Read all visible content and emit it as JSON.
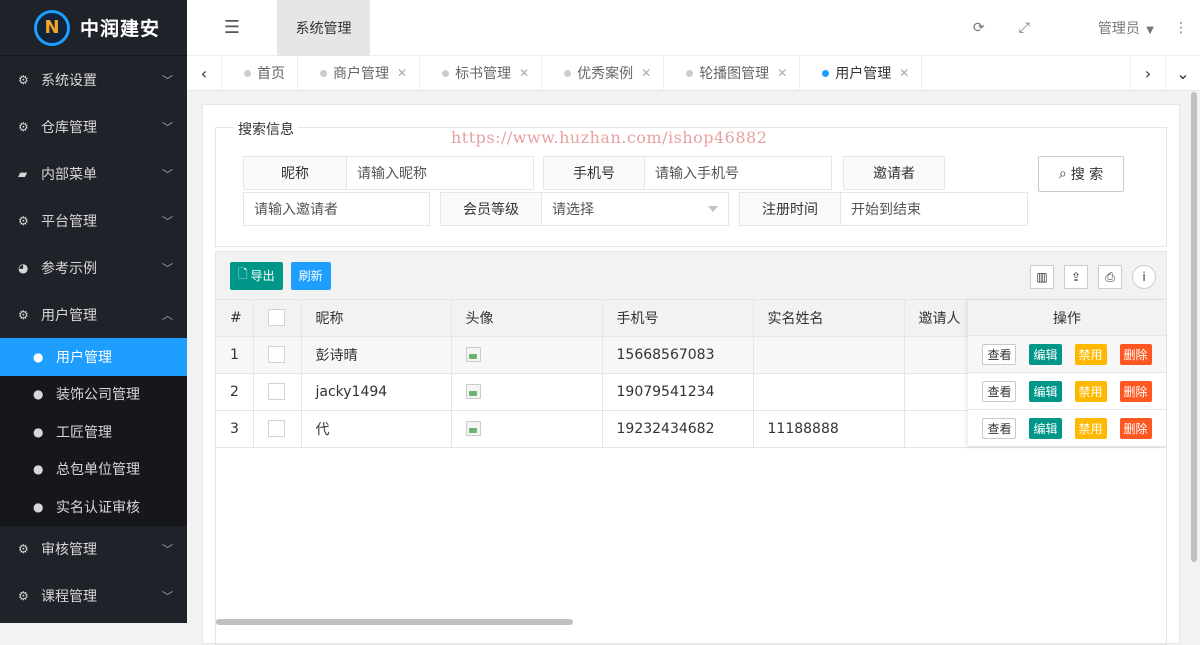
{
  "logo": {
    "text": "中润建安",
    "mark": "N"
  },
  "sidebar": {
    "items_top": [
      {
        "label": "系统设置"
      },
      {
        "label": "仓库管理"
      },
      {
        "label": "内部菜单"
      },
      {
        "label": "平台管理"
      },
      {
        "label": "参考示例"
      },
      {
        "label": "用户管理"
      }
    ],
    "sub_items": [
      {
        "label": "用户管理"
      },
      {
        "label": "装饰公司管理"
      },
      {
        "label": "工匠管理"
      },
      {
        "label": "总包单位管理"
      },
      {
        "label": "实名认证审核"
      }
    ],
    "items_bottom": [
      {
        "label": "审核管理"
      },
      {
        "label": "课程管理"
      }
    ]
  },
  "header": {
    "module_tab": "系统管理",
    "user": "管理员"
  },
  "tabs": [
    {
      "label": "首页"
    },
    {
      "label": "商户管理"
    },
    {
      "label": "标书管理"
    },
    {
      "label": "优秀案例"
    },
    {
      "label": "轮播图管理"
    },
    {
      "label": "用户管理"
    }
  ],
  "watermark": "https://www.huzhan.com/ishop46882",
  "search": {
    "legend": "搜索信息",
    "nickname_label": "昵称",
    "nickname_placeholder": "请输入昵称",
    "phone_label": "手机号",
    "phone_placeholder": "请输入手机号",
    "inviter_label": "邀请者",
    "inviter_placeholder": "请输入邀请者",
    "level_label": "会员等级",
    "level_value": "请选择",
    "regtime_label": "注册时间",
    "regtime_value": "开始到结束",
    "search_button": "搜 索"
  },
  "toolbar": {
    "export_label": "导出",
    "refresh_label": "刷新"
  },
  "table": {
    "headers": {
      "index": "#",
      "nickname": "昵称",
      "avatar": "头像",
      "phone": "手机号",
      "realname": "实名姓名",
      "inviter": "邀请人",
      "ops": "操作"
    },
    "rows": [
      {
        "index": "1",
        "nickname": "彭诗晴",
        "phone": "15668567083",
        "realname": "",
        "inviter": ""
      },
      {
        "index": "2",
        "nickname": "jacky1494",
        "phone": "19079541234",
        "realname": "",
        "inviter": ""
      },
      {
        "index": "3",
        "nickname": "代",
        "phone": "19232434682",
        "realname": "11188888",
        "inviter": ""
      }
    ],
    "actions": {
      "view": "查看",
      "edit": "编辑",
      "disable": "禁用",
      "delete": "删除"
    }
  }
}
